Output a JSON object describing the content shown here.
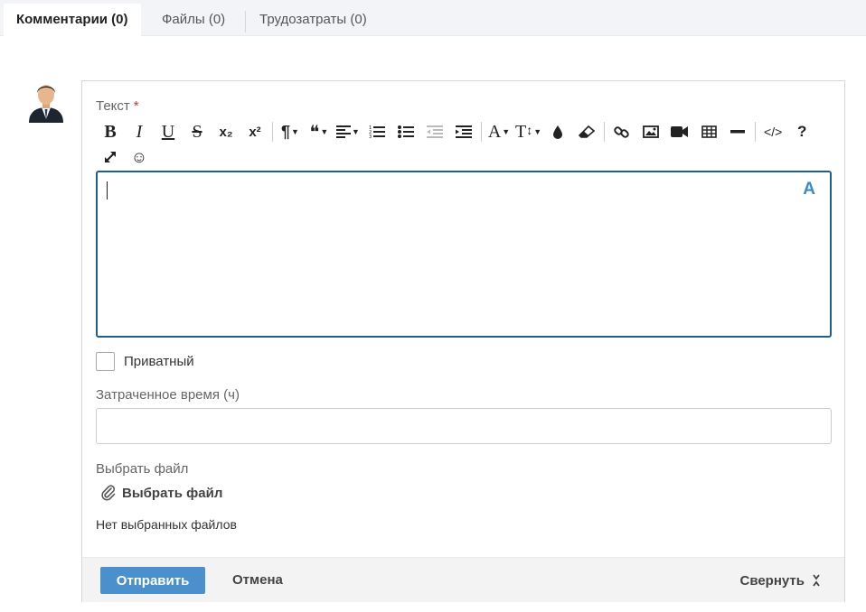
{
  "tabs": [
    {
      "label": "Комментарии (0)",
      "active": true
    },
    {
      "label": "Файлы (0)",
      "active": false
    },
    {
      "label": "Трудозатраты (0)",
      "active": false
    }
  ],
  "form": {
    "text_label": "Текст",
    "required_mark": "*",
    "editor_badge": "A",
    "editor_value": "",
    "private_label": "Приватный",
    "private_checked": false,
    "time_label": "Затраченное время (ч)",
    "time_value": "",
    "file_label": "Выбрать файл",
    "file_button_label": "Выбрать файл",
    "no_files_text": "Нет выбранных файлов"
  },
  "toolbar": {
    "bold": "B",
    "italic": "I",
    "underline": "U",
    "strike": "S",
    "subscript": "x₂",
    "superscript": "x²",
    "paragraph": "¶",
    "quote": "❝",
    "font_color": "A",
    "font_size": "T",
    "help": "?",
    "emoji": "☺",
    "code": "</>"
  },
  "footer": {
    "submit_label": "Отправить",
    "cancel_label": "Отмена",
    "collapse_label": "Свернуть"
  },
  "colors": {
    "accent": "#4a90cc",
    "editor_border": "#1f5f8f",
    "required": "#c0392b"
  }
}
